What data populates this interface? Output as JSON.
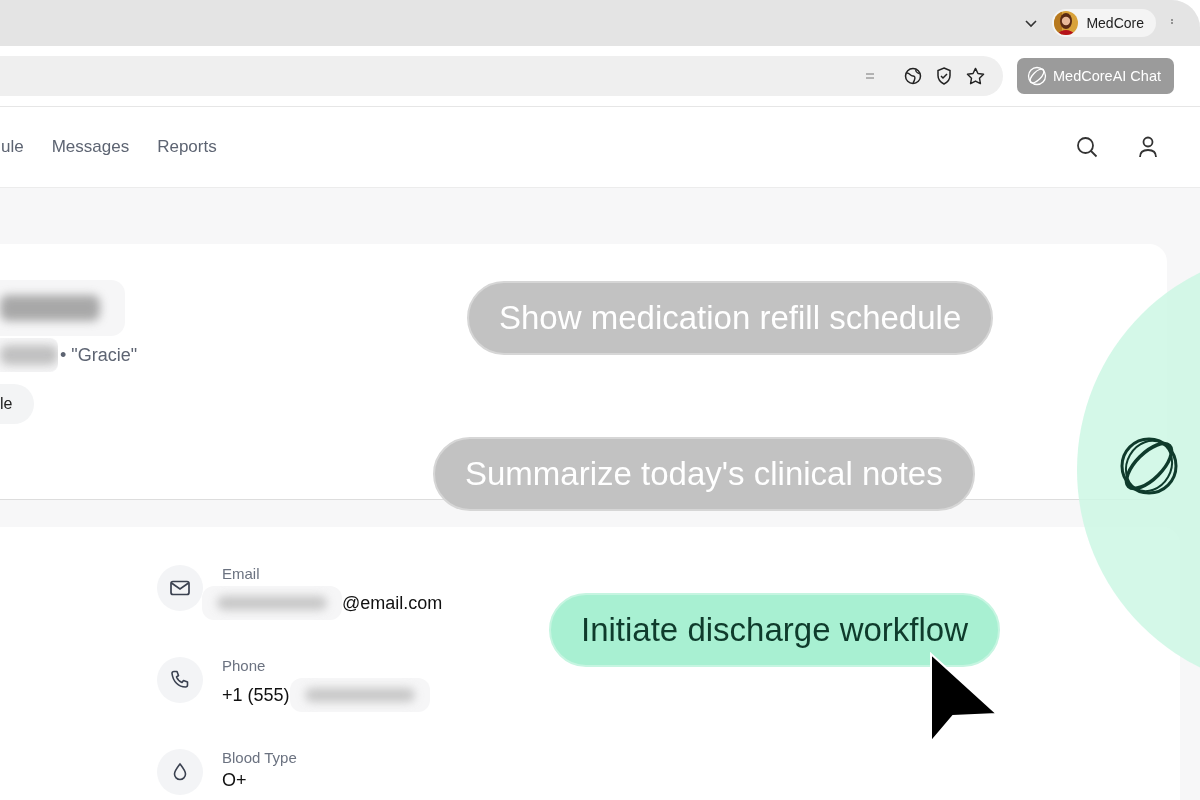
{
  "browser": {
    "profile_name": "MedCore",
    "chat_button": "MedCoreAI Chat"
  },
  "nav": {
    "items": [
      "ule",
      "Messages",
      "Reports"
    ]
  },
  "patient": {
    "nickname": "• \"Gracie\"",
    "chip": "le"
  },
  "contact": [
    {
      "kind": "email",
      "label": "Email",
      "value": "@email.com",
      "redacted_before": true,
      "redacted_after": false
    },
    {
      "kind": "phone",
      "label": "Phone",
      "value": "+1 (555)",
      "redacted_before": false,
      "redacted_after": true
    },
    {
      "kind": "blood",
      "label": "Blood Type",
      "value": "O+",
      "redacted_before": false,
      "redacted_after": false
    }
  ],
  "suggestions": [
    {
      "text": "Show medication refill schedule",
      "highlighted": false
    },
    {
      "text": "Summarize today's clinical notes",
      "highlighted": false
    },
    {
      "text": "Initiate discharge workflow",
      "highlighted": true
    }
  ]
}
